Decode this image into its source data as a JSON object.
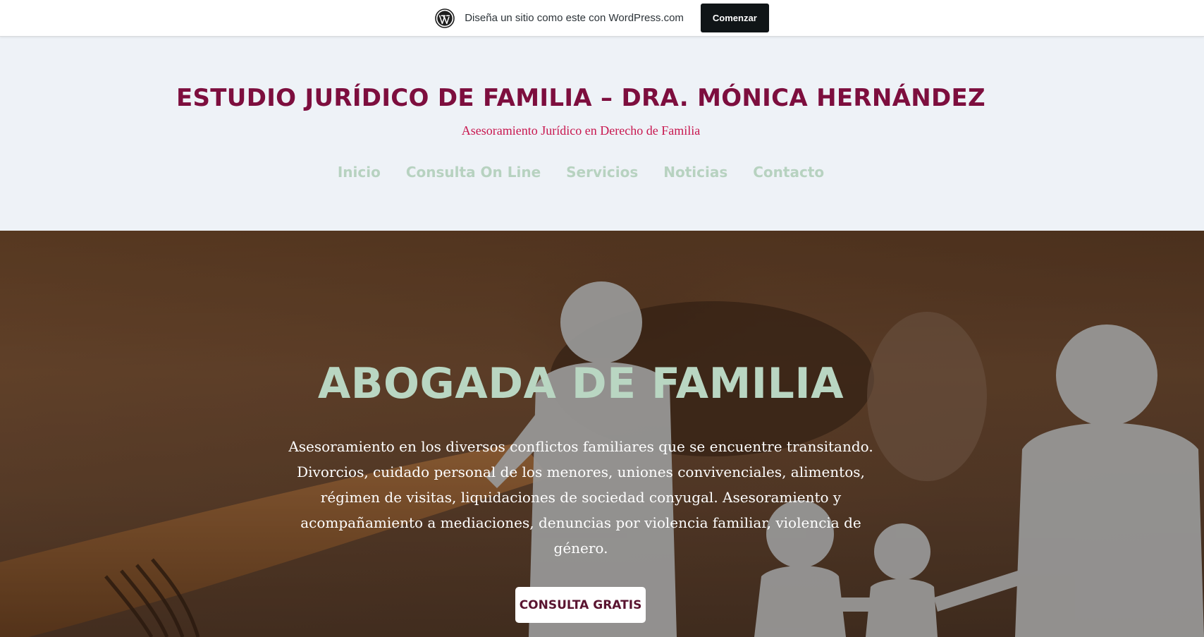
{
  "wp_banner": {
    "icon": "wordpress-icon",
    "text": "Diseña un sitio como este con WordPress.com",
    "button_label": "Comenzar"
  },
  "header": {
    "site_title": "ESTUDIO JURÍDICO DE FAMILIA – DRA. MÓNICA HERNÁNDEZ",
    "tagline": "Asesoramiento Jurídico en Derecho de Familia"
  },
  "nav": {
    "items": [
      {
        "label": "Inicio"
      },
      {
        "label": "Consulta On Line"
      },
      {
        "label": "Servicios"
      },
      {
        "label": "Noticias"
      },
      {
        "label": "Contacto"
      }
    ]
  },
  "hero": {
    "title": "ABOGADA DE FAMILIA",
    "text": "Asesoramiento en los diversos conflictos familiares que se encuentre transitando. Divorcios, cuidado personal de los menores, uniones convivenciales, alimentos, régimen de visitas, liquidaciones de sociedad conyugal. Asesoramiento y acompañamiento a mediaciones, denuncias por violencia familiar, violencia de género.",
    "button_label": "CONSULTA GRATIS"
  },
  "colors": {
    "site_title": "#7d0e3e",
    "tagline": "#c8174f",
    "nav_link": "#b7d2c0",
    "hero_title": "#b9d6c2",
    "header_bg": "#eef2f7"
  }
}
